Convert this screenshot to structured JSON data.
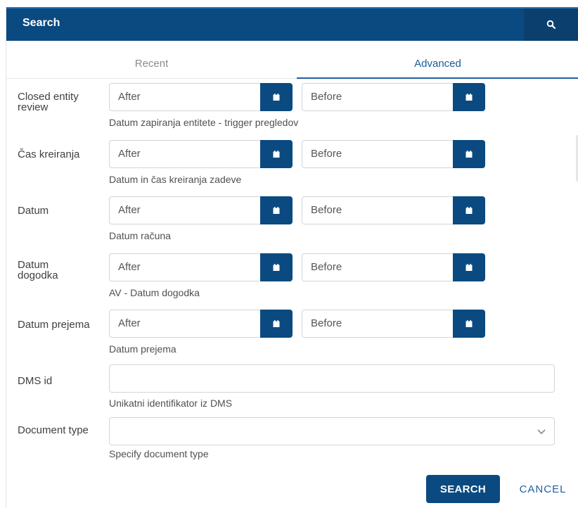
{
  "header": {
    "title": "Search",
    "search_icon": "search-icon"
  },
  "tabs": [
    {
      "label": "Recent",
      "active": false
    },
    {
      "label": "Advanced",
      "active": true
    }
  ],
  "fields": [
    {
      "label": "Closed entity review",
      "after_placeholder": "After",
      "before_placeholder": "Before",
      "helper": "Datum zapiranja entitete - trigger pregledov"
    },
    {
      "label": "Čas kreiranja",
      "after_placeholder": "After",
      "before_placeholder": "Before",
      "helper": "Datum in čas kreiranja zadeve"
    },
    {
      "label": "Datum",
      "after_placeholder": "After",
      "before_placeholder": "Before",
      "helper": "Datum računa"
    },
    {
      "label": "Datum dogodka",
      "after_placeholder": "After",
      "before_placeholder": "Before",
      "helper": "AV - Datum dogodka"
    },
    {
      "label": "Datum prejema",
      "after_placeholder": "After",
      "before_placeholder": "Before",
      "helper": "Datum prejema"
    }
  ],
  "dms": {
    "label": "DMS id",
    "value": "",
    "helper": "Unikatni identifikator iz DMS"
  },
  "doctype": {
    "label": "Document type",
    "value": "",
    "helper": "Specify document type"
  },
  "actions": {
    "search_label": "SEARCH",
    "cancel_label": "CANCEL"
  },
  "colors": {
    "primary": "#0b4a80",
    "accent": "#1f5f9f"
  },
  "icons": {
    "calendar": "calendar-icon",
    "chevron": "chevron-down-icon"
  }
}
